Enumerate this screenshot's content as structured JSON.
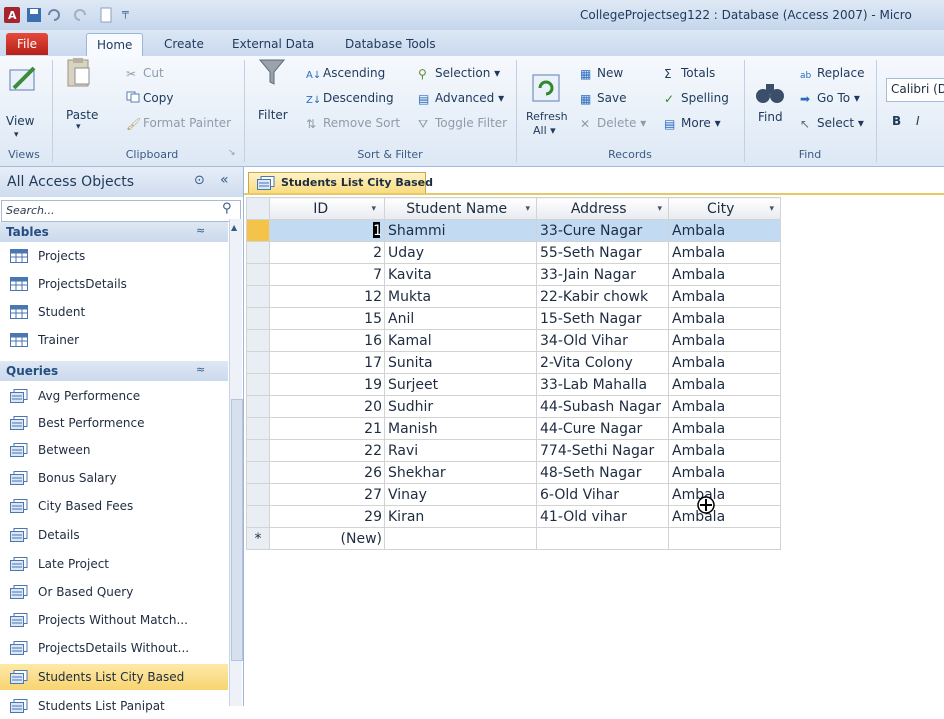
{
  "titlebar": {
    "title": "CollegeProjectseg122 : Database (Access 2007)  -  Micro"
  },
  "ribbon_tabs": [
    "File",
    "Home",
    "Create",
    "External Data",
    "Database Tools"
  ],
  "ribbon": {
    "views": {
      "view_label": "View",
      "group": "Views"
    },
    "clipboard": {
      "paste": "Paste",
      "cut": "Cut",
      "copy": "Copy",
      "format_painter": "Format Painter",
      "group": "Clipboard"
    },
    "sort_filter": {
      "filter": "Filter",
      "ascending": "Ascending",
      "descending": "Descending",
      "remove_sort": "Remove Sort",
      "selection": "Selection ▾",
      "advanced": "Advanced ▾",
      "toggle_filter": "Toggle Filter",
      "group": "Sort & Filter"
    },
    "records": {
      "refresh": "Refresh",
      "refresh_all": "All ▾",
      "new": "New",
      "save": "Save",
      "delete": "Delete ▾",
      "totals": "Totals",
      "spelling": "Spelling",
      "more": "More ▾",
      "group": "Records"
    },
    "find": {
      "find": "Find",
      "replace": "Replace",
      "goto": "Go To ▾",
      "select": "Select ▾",
      "group": "Find"
    },
    "text_formatting": {
      "font": "Calibri (D",
      "bold": "B",
      "italic": "I"
    }
  },
  "nav": {
    "header": "All Access Objects",
    "search_placeholder": "Search...",
    "tables_label": "Tables",
    "tables": [
      "Projects",
      "ProjectsDetails",
      "Student",
      "Trainer"
    ],
    "queries_label": "Queries",
    "queries": [
      "Avg Performence",
      "Best Performence",
      "Between",
      "Bonus Salary",
      "City Based Fees",
      "Details",
      "Late Project",
      "Or Based Query",
      "Projects Without Match...",
      "ProjectsDetails Without...",
      "Students List City Based",
      "Students List Panipat"
    ]
  },
  "document": {
    "tab_title": "Students List City Based",
    "columns": [
      "ID",
      "Student Name",
      "Address",
      "City"
    ],
    "rows": [
      [
        "1",
        "Shammi",
        "33-Cure Nagar",
        "Ambala"
      ],
      [
        "2",
        "Uday",
        "55-Seth Nagar",
        "Ambala"
      ],
      [
        "7",
        "Kavita",
        "33-Jain Nagar",
        "Ambala"
      ],
      [
        "12",
        "Mukta",
        "22-Kabir chowk",
        "Ambala"
      ],
      [
        "15",
        "Anil",
        "15-Seth Nagar",
        "Ambala"
      ],
      [
        "16",
        "Kamal",
        "34-Old Vihar",
        "Ambala"
      ],
      [
        "17",
        "Sunita",
        "2-Vita Colony",
        "Ambala"
      ],
      [
        "19",
        "Surjeet",
        "33-Lab Mahalla",
        "Ambala"
      ],
      [
        "20",
        "Sudhir",
        "44-Subash Nagar",
        "Ambala"
      ],
      [
        "21",
        "Manish",
        "44-Cure Nagar",
        "Ambala"
      ],
      [
        "22",
        "Ravi",
        "774-Sethi Nagar",
        "Ambala"
      ],
      [
        "26",
        "Shekhar",
        "48-Seth Nagar",
        "Ambala"
      ],
      [
        "27",
        "Vinay",
        "6-Old Vihar",
        "Ambala"
      ],
      [
        "29",
        "Kiran",
        "41-Old vihar",
        "Ambala"
      ]
    ],
    "new_row_marker": "*",
    "new_row_label": "(New)"
  },
  "colors": {
    "accent": "#2b579a",
    "selected_row": "#c2dbf3",
    "selected_nav": "#f8d470",
    "file_tab": "#c0291f"
  }
}
